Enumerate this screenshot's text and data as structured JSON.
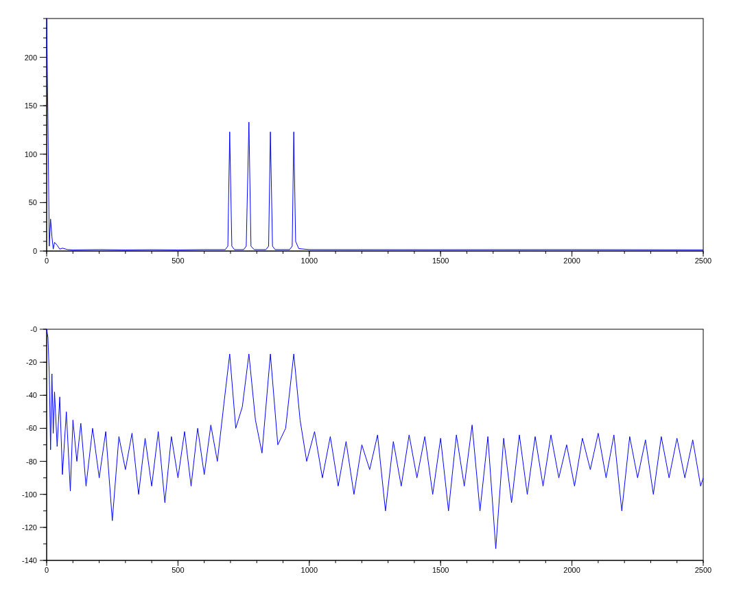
{
  "plots": [
    {
      "chart_data": {
        "type": "line",
        "xlim": [
          0,
          2500
        ],
        "ylim": [
          0,
          240
        ],
        "xticks": [
          0,
          500,
          1000,
          1500,
          2000,
          2500
        ],
        "yticks": [
          0,
          50,
          100,
          150,
          200
        ],
        "x": [
          0,
          5,
          10,
          15,
          20,
          25,
          30,
          40,
          50,
          60,
          80,
          100,
          200,
          300,
          400,
          500,
          600,
          680,
          690,
          697,
          705,
          715,
          750,
          760,
          770,
          778,
          790,
          835,
          845,
          852,
          860,
          870,
          925,
          935,
          941,
          948,
          960,
          1000,
          1500,
          2000,
          2500
        ],
        "series": [
          {
            "color": "#0000ff",
            "values": [
              240,
              135,
              5,
              33,
              15,
              2,
              9,
              6,
              2,
              3,
              1.5,
              1.2,
              1.5,
              1.2,
              1.4,
              1.2,
              1.5,
              1.5,
              5,
              123,
              5,
              1.5,
              1.5,
              5,
              133,
              5,
              1.5,
              1.5,
              5,
              123,
              5,
              1.5,
              1.5,
              5,
              123,
              10,
              2.5,
              1.5,
              1.4,
              1.5,
              1.3
            ]
          }
        ]
      }
    },
    {
      "chart_data": {
        "type": "line",
        "xlim": [
          0,
          2500
        ],
        "ylim": [
          -140,
          0
        ],
        "xticks": [
          0,
          500,
          1000,
          1500,
          2000,
          2500
        ],
        "yticks": [
          {
            "value": 0,
            "label": "-0"
          },
          -20,
          -40,
          -60,
          -80,
          -100,
          -120,
          -140
        ],
        "x": [
          0,
          5,
          10,
          15,
          20,
          25,
          30,
          40,
          50,
          60,
          75,
          90,
          100,
          115,
          130,
          150,
          175,
          200,
          225,
          250,
          275,
          300,
          325,
          350,
          375,
          400,
          425,
          450,
          475,
          500,
          525,
          550,
          575,
          600,
          625,
          650,
          675,
          697,
          720,
          745,
          770,
          795,
          820,
          852,
          880,
          910,
          941,
          965,
          990,
          1020,
          1050,
          1080,
          1110,
          1140,
          1170,
          1200,
          1230,
          1260,
          1290,
          1320,
          1350,
          1380,
          1410,
          1440,
          1470,
          1500,
          1530,
          1560,
          1590,
          1620,
          1650,
          1680,
          1710,
          1740,
          1770,
          1800,
          1830,
          1860,
          1890,
          1920,
          1950,
          1980,
          2010,
          2040,
          2070,
          2100,
          2130,
          2160,
          2190,
          2220,
          2250,
          2280,
          2310,
          2340,
          2370,
          2400,
          2430,
          2460,
          2490,
          2500
        ],
        "series": [
          {
            "color": "#0000ff",
            "values": [
              0,
              -5,
              -27,
              -73,
              -27,
              -63,
              -38,
              -71,
              -41,
              -88,
              -50,
              -98,
              -55,
              -80,
              -57,
              -95,
              -60,
              -90,
              -62,
              -116,
              -65,
              -85,
              -63,
              -100,
              -66,
              -95,
              -62,
              -105,
              -65,
              -90,
              -62,
              -95,
              -60,
              -88,
              -58,
              -80,
              -45,
              -15,
              -60,
              -47,
              -15,
              -55,
              -75,
              -15,
              -70,
              -60,
              -15,
              -55,
              -80,
              -62,
              -90,
              -65,
              -95,
              -68,
              -100,
              -70,
              -85,
              -64,
              -110,
              -68,
              -95,
              -64,
              -90,
              -65,
              -100,
              -66,
              -110,
              -64,
              -95,
              -58,
              -110,
              -65,
              -133,
              -66,
              -105,
              -64,
              -100,
              -65,
              -95,
              -64,
              -90,
              -70,
              -95,
              -66,
              -85,
              -63,
              -90,
              -64,
              -110,
              -65,
              -90,
              -67,
              -100,
              -65,
              -90,
              -66,
              -90,
              -67,
              -95,
              -90
            ]
          }
        ]
      }
    }
  ]
}
